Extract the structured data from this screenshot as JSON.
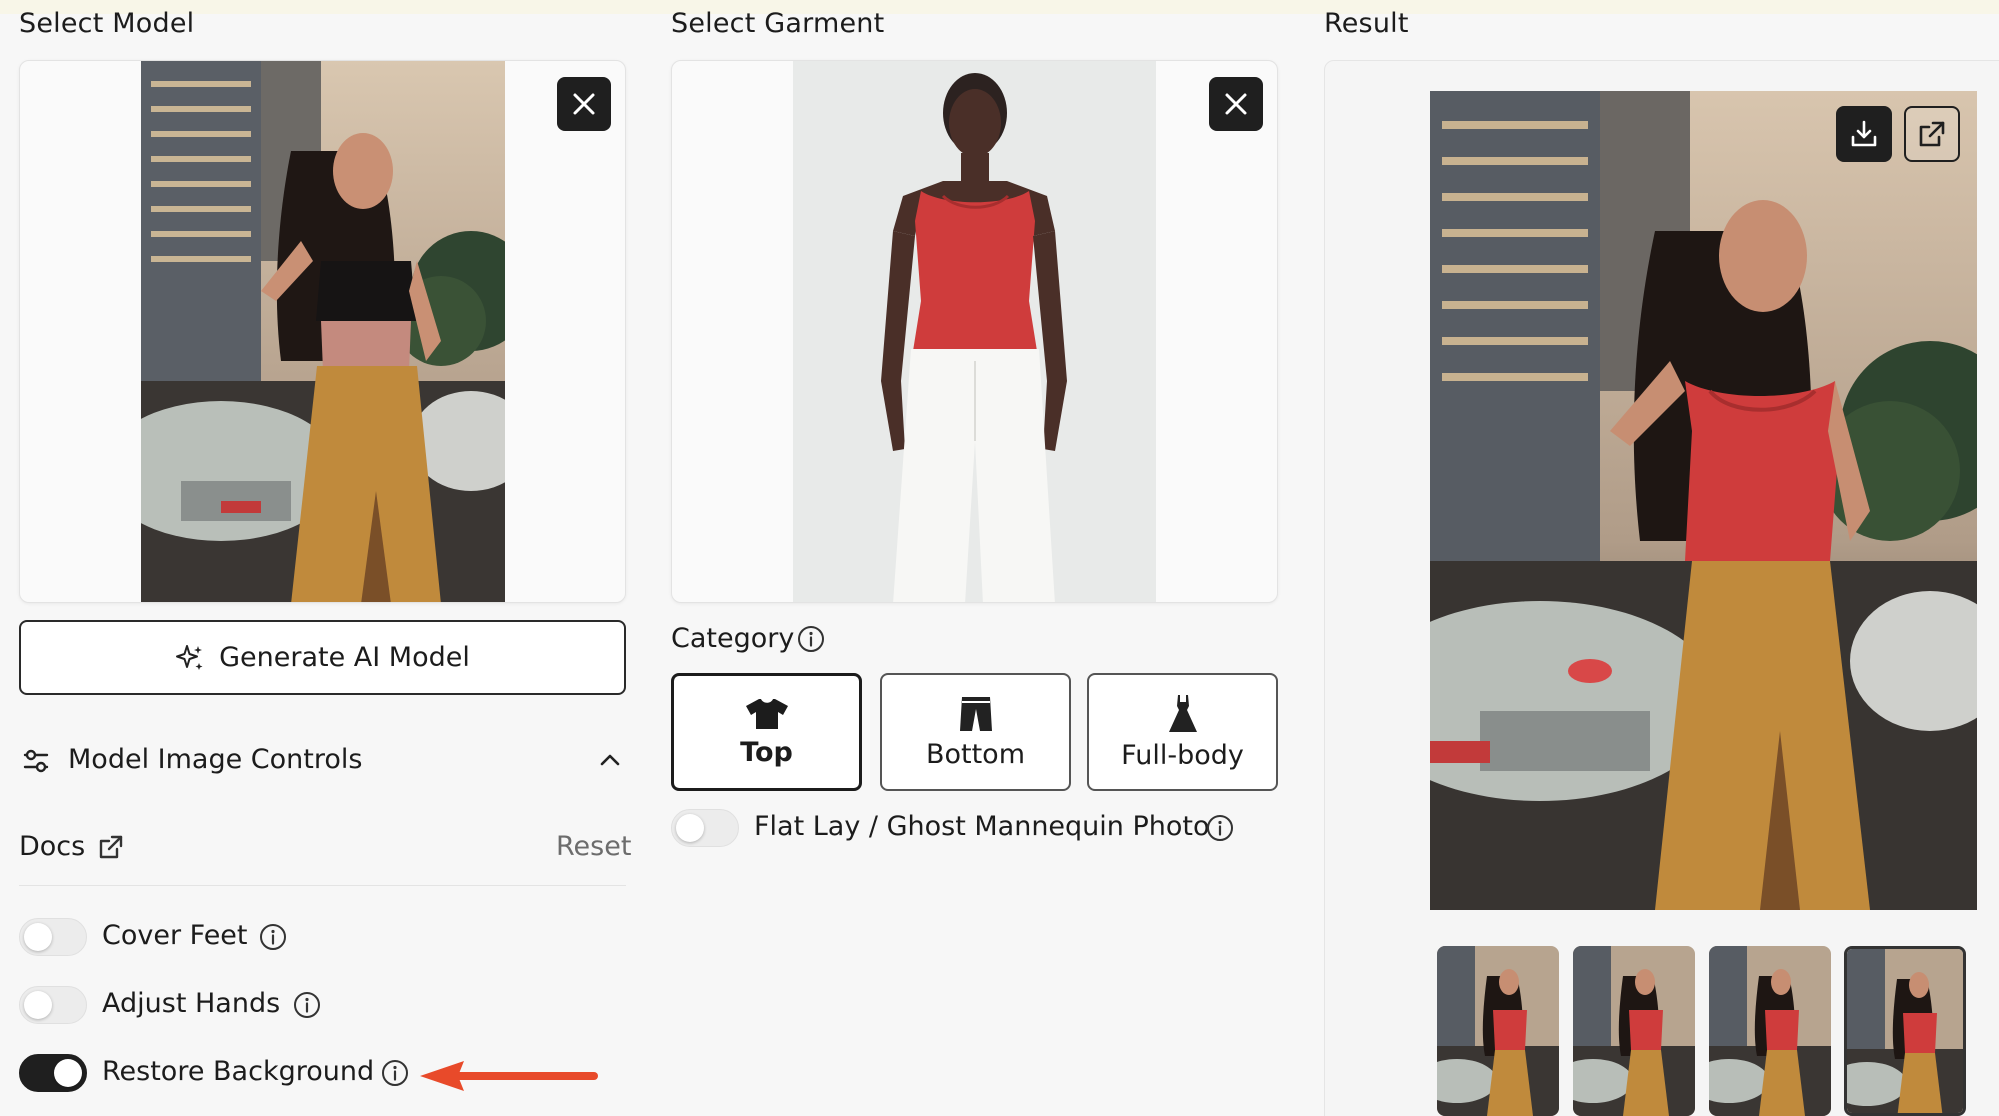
{
  "columns": {
    "model_title": "Select Model",
    "garment_title": "Select Garment",
    "result_title": "Result"
  },
  "model": {
    "generate_label": "Generate AI Model",
    "controls_title": "Model Image Controls",
    "docs_label": "Docs",
    "reset_label": "Reset",
    "toggles": [
      {
        "label": "Cover Feet",
        "on": false
      },
      {
        "label": "Adjust Hands",
        "on": false
      },
      {
        "label": "Restore Background",
        "on": true
      }
    ]
  },
  "garment": {
    "category_label": "Category",
    "categories": [
      {
        "label": "Top",
        "selected": true
      },
      {
        "label": "Bottom",
        "selected": false
      },
      {
        "label": "Full-body",
        "selected": false
      }
    ],
    "flatlay_label": "Flat Lay / Ghost Mannequin Photo",
    "flatlay_on": false
  },
  "colors": {
    "accent_arrow": "#e84a2a",
    "dark": "#1f1f1f",
    "red_top": "#cf3c3c",
    "skirt": "#c08a3c"
  },
  "icons": [
    "close-icon",
    "sparkle-icon",
    "sliders-icon",
    "chevron-up-icon",
    "external-link-icon",
    "info-icon",
    "shirt-icon",
    "pants-icon",
    "dress-icon",
    "download-icon"
  ]
}
